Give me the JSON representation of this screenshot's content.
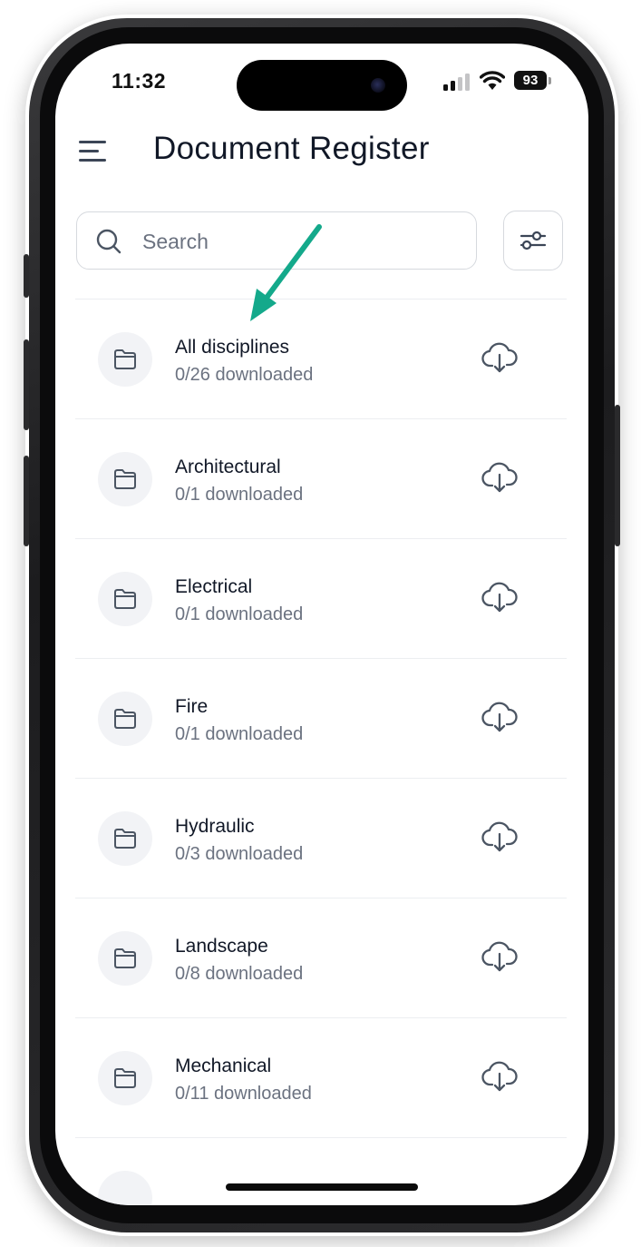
{
  "status_bar": {
    "time": "11:32",
    "battery": "93"
  },
  "header": {
    "title": "Document Register",
    "menu_icon": "hamburger-menu-icon"
  },
  "search": {
    "placeholder": "Search",
    "value": ""
  },
  "filter_icon": "filter-sliders-icon",
  "disciplines": [
    {
      "name": "All disciplines",
      "status": "0/26 downloaded"
    },
    {
      "name": "Architectural",
      "status": "0/1 downloaded"
    },
    {
      "name": "Electrical",
      "status": "0/1 downloaded"
    },
    {
      "name": "Fire",
      "status": "0/1 downloaded"
    },
    {
      "name": "Hydraulic",
      "status": "0/3 downloaded"
    },
    {
      "name": "Landscape",
      "status": "0/8 downloaded"
    },
    {
      "name": "Mechanical",
      "status": "0/11 downloaded"
    }
  ],
  "row_icons": {
    "leading": "folder-icon",
    "trailing": "cloud-download-icon"
  },
  "colors": {
    "accent_arrow": "#14a98b",
    "text_primary": "#111827",
    "text_secondary": "#6b7280",
    "icon": "#4b5563"
  }
}
